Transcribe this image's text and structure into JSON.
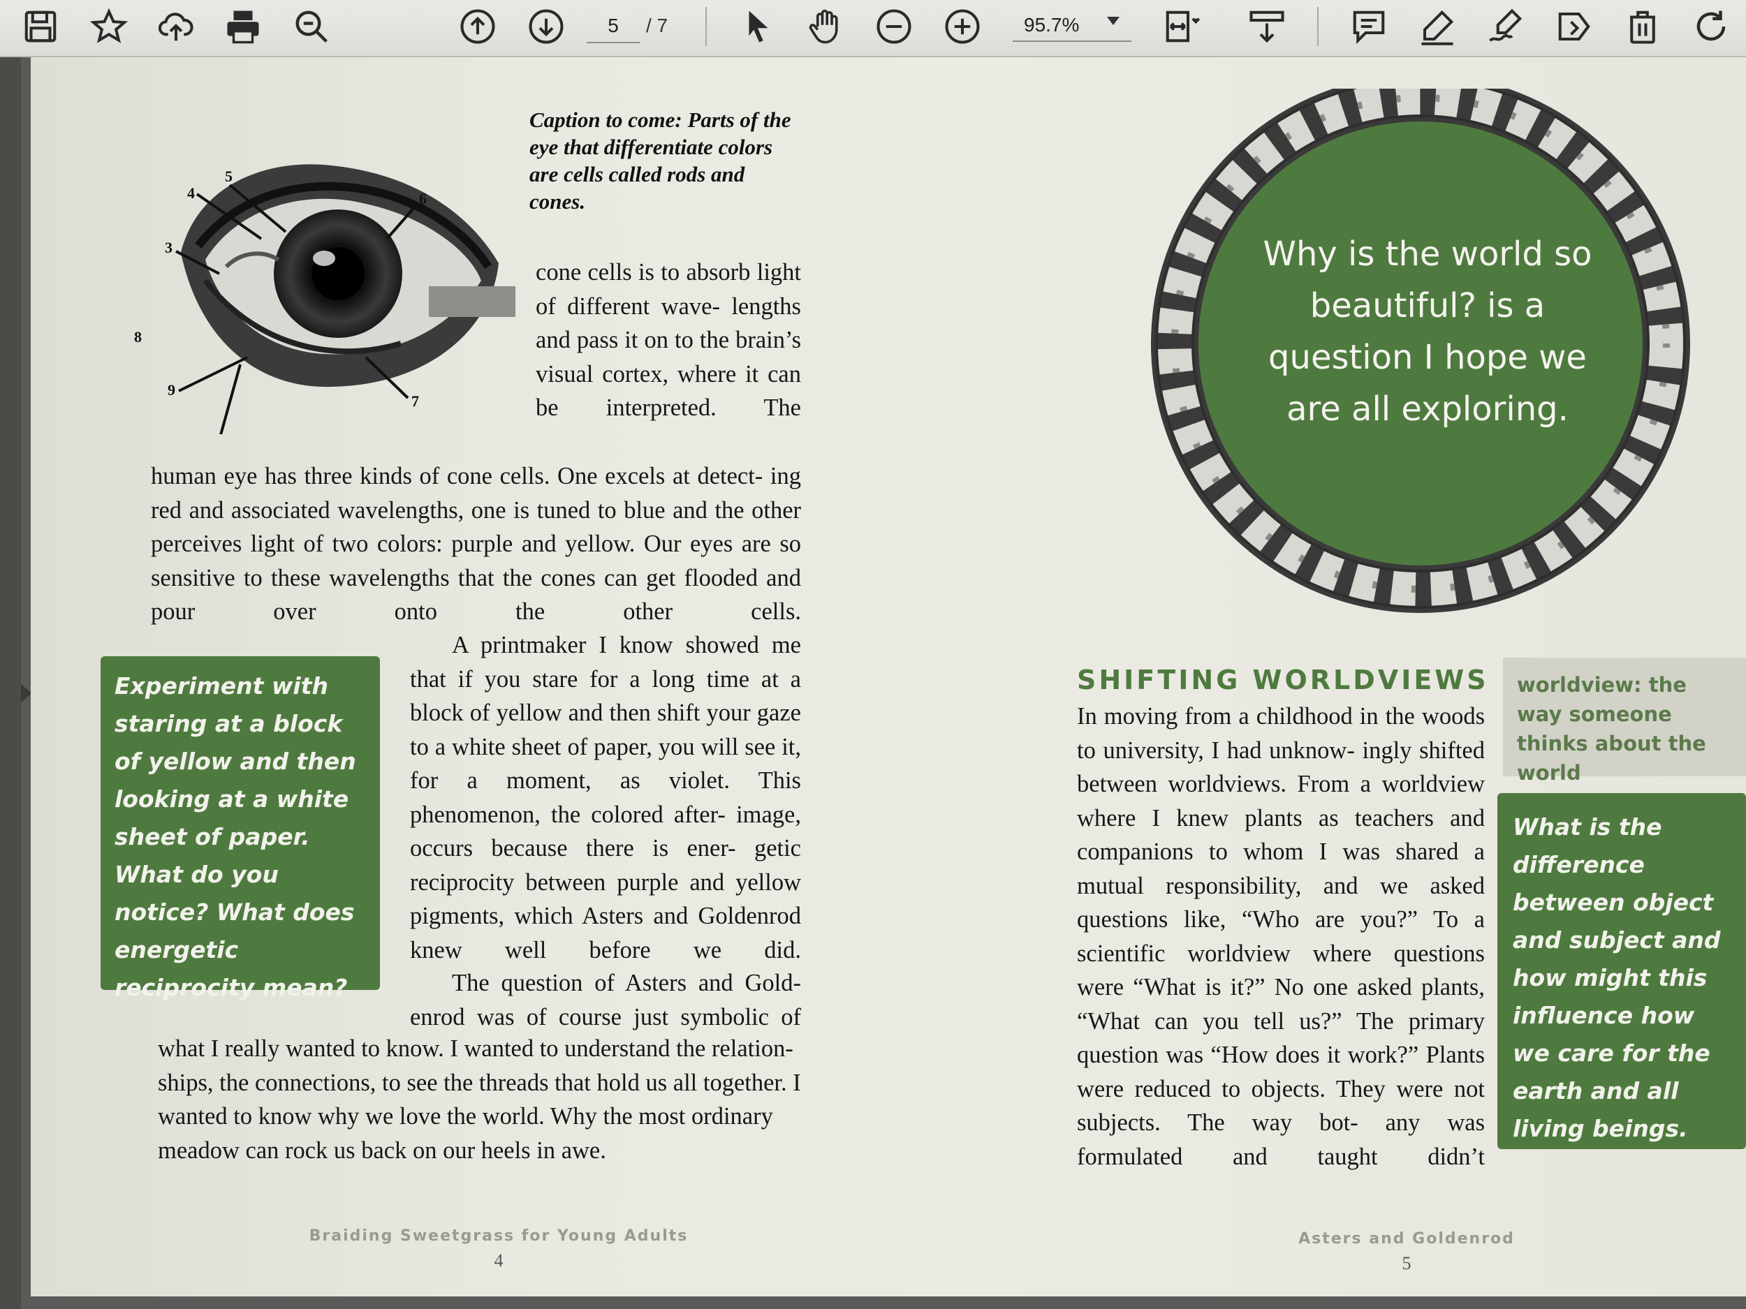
{
  "toolbar": {
    "page_current": "5",
    "page_total": "/ 7",
    "zoom": "95.7%",
    "left_tools": [
      "save-icon",
      "bookmark-star-icon",
      "upload-cloud-icon",
      "print-icon",
      "zoom-search-icon"
    ],
    "nav_tools": [
      "page-up-icon",
      "page-down-icon"
    ],
    "mode_tools": [
      "select-arrow-icon",
      "hand-pan-icon",
      "zoom-out-icon",
      "zoom-in-icon"
    ],
    "right_tools": [
      "fit-page-icon",
      "scroll-mode-icon",
      "comment-icon",
      "highlight-pen-icon",
      "sign-icon",
      "tag-icon",
      "trash-icon",
      "rotate-icon"
    ]
  },
  "colors": {
    "accent_green": "#4f7a3f",
    "gloss_bg": "#d2d2c9"
  },
  "left_page": {
    "caption": "Caption to come: Parts of the eye that differentiate colors are cells called rods and cones.",
    "figure_labels": [
      "5",
      "4",
      "6",
      "3",
      "8",
      "9",
      "7"
    ],
    "para1_narrow": "cone cells is to absorb light of different wave- lengths and pass it on to the brain’s visual cortex, where it can be interpreted. The",
    "para1_wide": "human eye has three kinds of cone cells. One excels at detect- ing red and associated wavelengths, one is tuned to blue and the other perceives light of two colors: purple and yellow. Our eyes are so sensitive to these wavelengths that the cones can get flooded and pour over onto the other cells.",
    "para2": "A printmaker I know showed me that if you stare for a long time at a block of yellow and then shift your gaze to a white sheet of paper, you will see it, for a moment, as violet. This phenomenon, the colored after- image, occurs because there is ener- getic reciprocity between purple and yellow pigments, which Asters and Goldenrod knew well before we did.",
    "para3_start": "The question of Asters and Gold- enrod was of course just symbolic of",
    "para3_rest": "what I really wanted to know. I wanted to understand the relation- ships, the connections, to see the threads that hold us all together. I wanted to know why we love the world. Why the most ordinary meadow can rock us back on our heels in awe.",
    "prompt_box": "Experiment with staring at a block of yellow and then looking at a white sheet of paper. What do you notice? What does energetic reciprocity mean?",
    "footer_title": "Braiding Sweetgrass for Young Adults",
    "page_number": "4"
  },
  "right_page": {
    "wreath_quote": "Why is the world so beautiful? is a question I hope we are all exploring.",
    "section_title": "SHIFTING WORLDVIEWS",
    "body": "In moving from a childhood in the woods to university, I had unknow- ingly shifted between worldviews. From a worldview where I knew plants as teachers and companions to whom I was shared a mutual responsibility, and we asked questions like, “Who are you?” To a scientific worldview where questions were “What is it?” No one asked plants, “What can you tell us?” The primary question was “How does it work?” Plants were reduced to objects. They were not subjects. The way bot- any was formulated and taught didn’t",
    "glossary": "worldview: the way someone thinks about the world",
    "prompt_box": "What is the difference between object and subject and how might this influence how we care for the earth and all living beings.",
    "footer_title": "Asters and Goldenrod",
    "page_number": "5"
  }
}
